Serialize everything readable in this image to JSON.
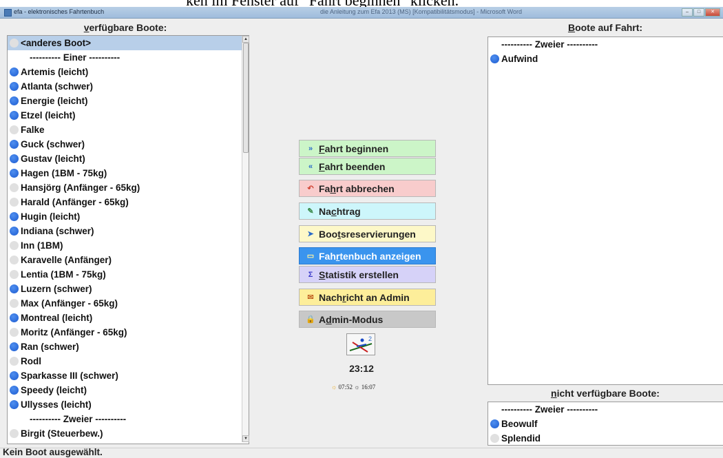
{
  "doc_fragment": "ken im Fenster auf \"Fahrt beginnen\" klicken.",
  "window": {
    "title": "efa - elektronisches Fahrtenbuch",
    "title_right": "die Anleitung zum Efa 2013 (MS) [Kompatibilitätsmodus] - Microsoft Word"
  },
  "available": {
    "header_ul": "v",
    "header_rest": "erfügbare Boote:",
    "items": [
      {
        "label": "<anderes Boot>",
        "dot": "grey",
        "selected": true
      },
      {
        "label": "---------- Einer ----------",
        "sep": true
      },
      {
        "label": "Artemis (leicht)",
        "dot": "blue"
      },
      {
        "label": "Atlanta (schwer)",
        "dot": "blue"
      },
      {
        "label": "Energie (leicht)",
        "dot": "blue"
      },
      {
        "label": "Etzel (leicht)",
        "dot": "blue"
      },
      {
        "label": "Falke",
        "dot": "grey"
      },
      {
        "label": "Guck (schwer)",
        "dot": "blue"
      },
      {
        "label": "Gustav (leicht)",
        "dot": "blue"
      },
      {
        "label": "Hagen (1BM - 75kg)",
        "dot": "blue"
      },
      {
        "label": "Hansjörg (Anfänger - 65kg)",
        "dot": "grey"
      },
      {
        "label": "Harald (Anfänger - 65kg)",
        "dot": "grey"
      },
      {
        "label": "Hugin (leicht)",
        "dot": "blue"
      },
      {
        "label": "Indiana (schwer)",
        "dot": "blue"
      },
      {
        "label": "Inn (1BM)",
        "dot": "grey"
      },
      {
        "label": "Karavelle (Anfänger)",
        "dot": "grey"
      },
      {
        "label": "Lentia (1BM - 75kg)",
        "dot": "grey"
      },
      {
        "label": "Luzern (schwer)",
        "dot": "blue"
      },
      {
        "label": "Max (Anfänger - 65kg)",
        "dot": "grey"
      },
      {
        "label": "Montreal (leicht)",
        "dot": "blue"
      },
      {
        "label": "Moritz (Anfänger - 65kg)",
        "dot": "grey"
      },
      {
        "label": "Ran (schwer)",
        "dot": "blue"
      },
      {
        "label": "Rodl",
        "dot": "grey"
      },
      {
        "label": "Sparkasse III (schwer)",
        "dot": "blue"
      },
      {
        "label": "Speedy (leicht)",
        "dot": "blue"
      },
      {
        "label": "Ullysses (leicht)",
        "dot": "blue"
      },
      {
        "label": "---------- Zweier ----------",
        "sep": true
      },
      {
        "label": "Birgit (Steuerbew.)",
        "dot": "grey"
      }
    ]
  },
  "on_trip": {
    "header_ul": "B",
    "header_rest": "oote auf Fahrt:",
    "items": [
      {
        "label": "---------- Zweier ----------",
        "sep": true
      },
      {
        "label": "Aufwind",
        "dot": "blue"
      }
    ]
  },
  "unavailable": {
    "header_ul": "n",
    "header_rest": "icht verfügbare Boote:",
    "items": [
      {
        "label": "---------- Zweier ----------",
        "sep": true
      },
      {
        "label": "Beowulf",
        "dot": "blue"
      },
      {
        "label": "Splendid",
        "dot": "grey"
      }
    ]
  },
  "buttons": [
    {
      "id": "start-trip-button",
      "icon": "»",
      "icon_name": "double-right-arrow-icon",
      "pre": "",
      "ul": "F",
      "post": "ahrt beginnen",
      "bg": "#ccf5c8",
      "fg_icon": "#2a6ac8"
    },
    {
      "id": "end-trip-button",
      "icon": "«",
      "icon_name": "double-left-arrow-icon",
      "pre": "",
      "ul": "F",
      "post": "ahrt beenden",
      "bg": "#ccf5c8",
      "fg_icon": "#2a6ac8"
    },
    {
      "id": "abort-trip-button",
      "icon": "↶",
      "icon_name": "undo-arrow-icon",
      "pre": "Fa",
      "ul": "h",
      "post": "rt abbrechen",
      "bg": "#f8cccc",
      "fg_icon": "#d04030"
    },
    {
      "id": "late-entry-button",
      "icon": "✎",
      "icon_name": "late-entry-icon",
      "pre": "Na",
      "ul": "c",
      "post": "htrag",
      "bg": "#cdf6fb",
      "fg_icon": "#3a8a4a"
    },
    {
      "id": "reservations-button",
      "icon": "➤",
      "icon_name": "reservation-icon",
      "pre": "Boo",
      "ul": "t",
      "post": "sreservierungen",
      "bg": "#fdf8c8",
      "fg_icon": "#2a6ac8"
    },
    {
      "id": "show-logbook-button",
      "icon": "▭",
      "icon_name": "logbook-icon",
      "pre": "Fah",
      "ul": "r",
      "post": "tenbuch anzeigen",
      "bg": "#3a94ee",
      "fg_icon": "#fff2a0"
    },
    {
      "id": "statistics-button",
      "icon": "Σ",
      "icon_name": "sigma-icon",
      "pre": "",
      "ul": "S",
      "post": "tatistik erstellen",
      "bg": "#d6d2f8",
      "fg_icon": "#3a3ac8"
    },
    {
      "id": "message-admin-button",
      "icon": "✉",
      "icon_name": "envelope-icon",
      "pre": "Nach",
      "ul": "r",
      "post": "icht an Admin",
      "bg": "#fdee9a",
      "fg_icon": "#c06020"
    },
    {
      "id": "admin-mode-button",
      "icon": "🔒",
      "icon_name": "lock-icon",
      "pre": "A",
      "ul": "d",
      "post": "min-Modus",
      "bg": "#c8c8c8",
      "fg_icon": "#333"
    }
  ],
  "clock": "23:12",
  "sunrise": "07:52",
  "sunset": "16:07",
  "status": "Kein Boot ausgewählt."
}
